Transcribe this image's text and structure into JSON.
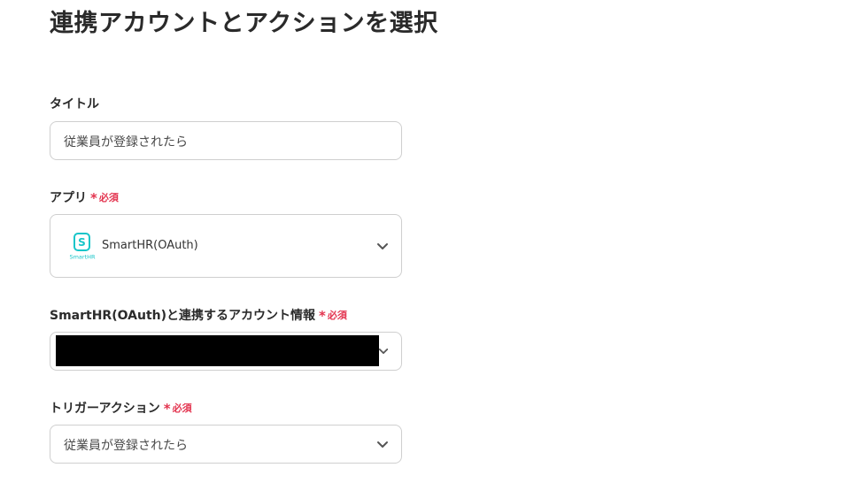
{
  "page": {
    "title": "連携アカウントとアクションを選択"
  },
  "fields": {
    "title": {
      "label": "タイトル",
      "value": "従業員が登録されたら"
    },
    "app": {
      "label": "アプリ",
      "required_star": "*",
      "required_text": "必須",
      "value": "SmartHR(OAuth)",
      "logo_text": "SmartHR",
      "logo_color": "#18c5c9",
      "icon": "chevron-down-icon"
    },
    "account": {
      "label": "SmartHR(OAuth)と連携するアカウント情報",
      "required_star": "*",
      "required_text": "必須",
      "icon": "chevron-down-icon"
    },
    "trigger": {
      "label": "トリガーアクション",
      "required_star": "*",
      "required_text": "必須",
      "value": "従業員が登録されたら",
      "icon": "chevron-down-icon"
    }
  },
  "colors": {
    "required": "#e3344f",
    "border": "#cfcfcf"
  }
}
